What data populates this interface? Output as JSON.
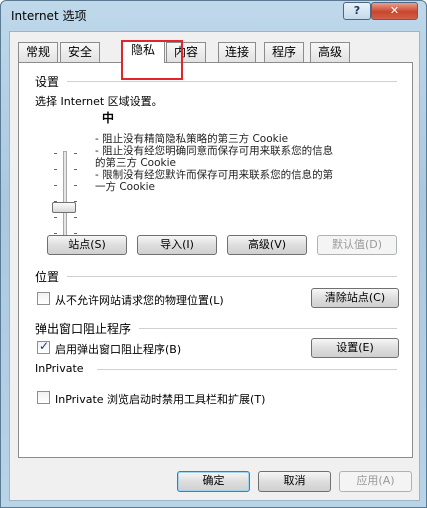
{
  "window": {
    "title": "Internet 选项",
    "help_label": "?",
    "close_label": "✕"
  },
  "tabs": [
    {
      "label": "常规"
    },
    {
      "label": "安全"
    },
    {
      "label": "隐私"
    },
    {
      "label": "内容"
    },
    {
      "label": "连接"
    },
    {
      "label": "程序"
    },
    {
      "label": "高级"
    }
  ],
  "active_tab": "隐私",
  "settings": {
    "group_title": "设置",
    "prompt": "选择 Internet 区域设置。",
    "level": "中",
    "description": "- 阻止没有精简隐私策略的第三方 Cookie\n- 阻止没有经您明确同意而保存可用来联系您的信息\n的第三方 Cookie\n- 限制没有经您默许而保存可用来联系您的信息的第\n一方 Cookie",
    "buttons": {
      "sites": "站点(S)",
      "import": "导入(I)",
      "advanced": "高级(V)",
      "default": "默认值(D)"
    }
  },
  "location": {
    "group_title": "位置",
    "checkbox_label": "从不允许网站请求您的物理位置(L)",
    "checked": false,
    "clear_button": "清除站点(C)"
  },
  "popup": {
    "group_title": "弹出窗口阻止程序",
    "checkbox_label": "启用弹出窗口阻止程序(B)",
    "checked": true,
    "settings_button": "设置(E)"
  },
  "inprivate": {
    "group_title": "InPrivate",
    "checkbox_label": "InPrivate 浏览启动时禁用工具栏和扩展(T)",
    "checked": false
  },
  "footer": {
    "ok": "确定",
    "cancel": "取消",
    "apply": "应用(A)"
  },
  "colors": {
    "title_bar": "#a9c8e0",
    "close_button": "#c9452c",
    "highlight_box": "#e0262c"
  }
}
